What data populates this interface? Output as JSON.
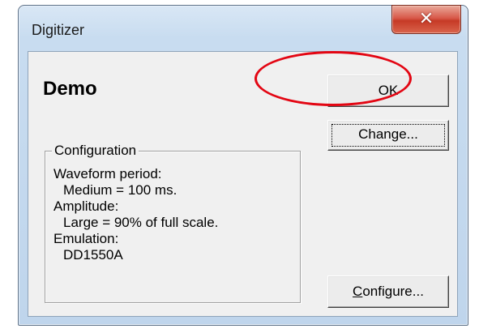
{
  "window": {
    "title": "Digitizer",
    "close_icon": "close-icon",
    "close_glyph": "✕"
  },
  "device": {
    "name": "Demo"
  },
  "buttons": {
    "ok": "OK",
    "change": "Change...",
    "configure_accel": "C",
    "configure_rest": "onfigure..."
  },
  "configuration": {
    "title": "Configuration",
    "waveform_label": "Waveform period:",
    "waveform_value": "Medium = 100 ms.",
    "amplitude_label": "Amplitude:",
    "amplitude_value": "Large = 90% of full scale.",
    "emulation_label": "Emulation:",
    "emulation_value": "DD1550A"
  },
  "colors": {
    "annotation": "#e30613",
    "close_button": "#c63a26",
    "dialog_background": "#f0f0f0"
  }
}
